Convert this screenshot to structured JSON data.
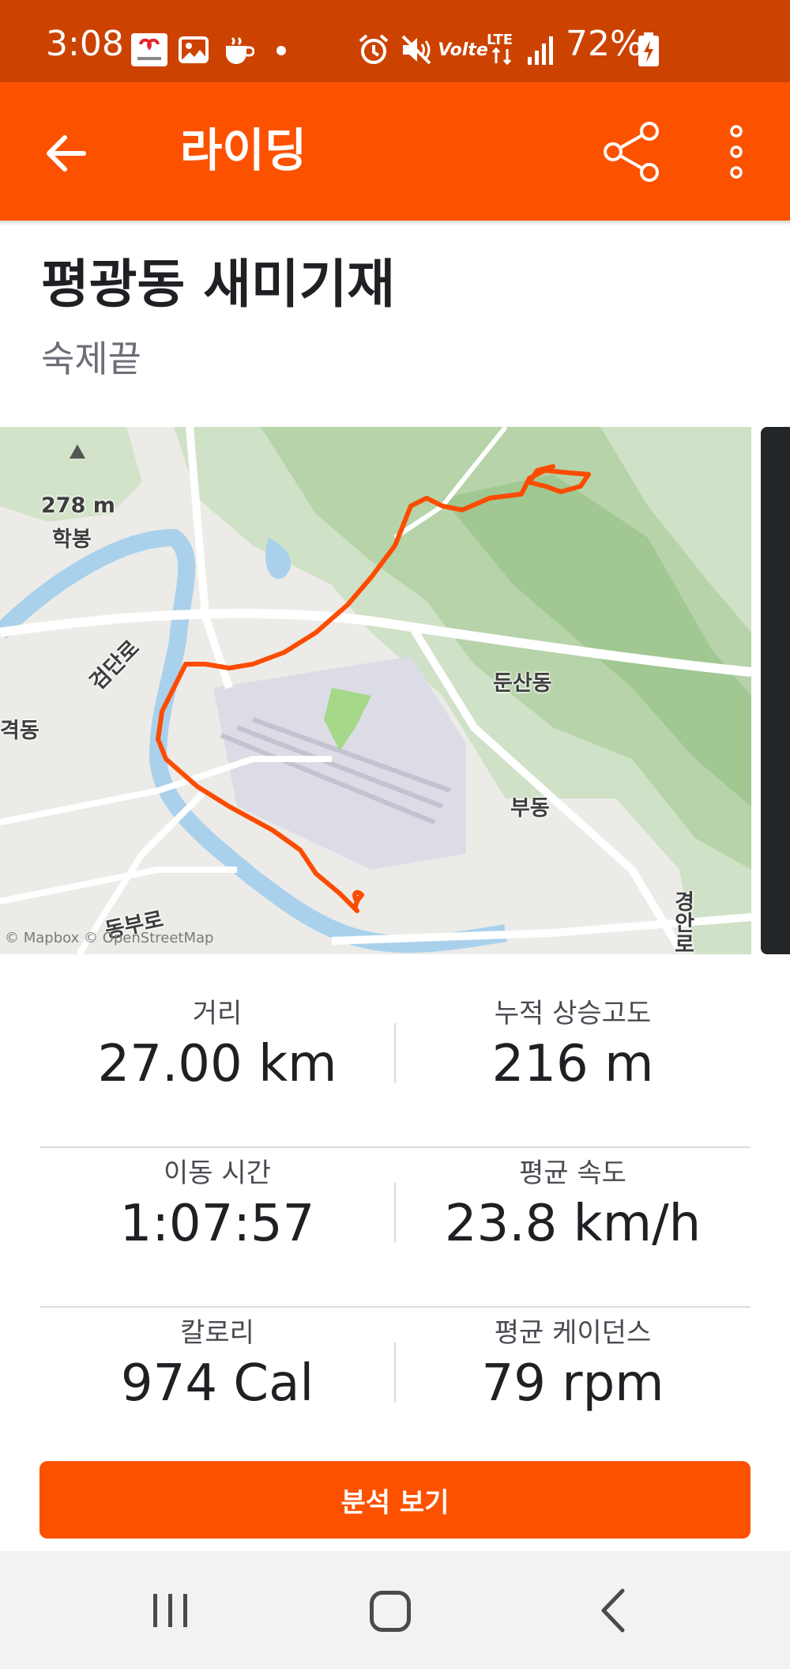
{
  "status_bar": {
    "time": "3:08",
    "battery_percent": "72%",
    "network": "LTE",
    "volte": "Volte",
    "icons": [
      "benepia-icon",
      "gallery-icon",
      "coffee-cup-icon",
      "notification-dot-icon",
      "alarm-icon",
      "mute-icon",
      "volte-icon",
      "lte-data-icon",
      "signal-icon",
      "battery-charging-icon"
    ]
  },
  "app_bar": {
    "title": "라이딩",
    "back_icon": "arrow-left-icon",
    "share_icon": "share-icon",
    "more_icon": "more-vertical-icon"
  },
  "activity": {
    "name": "평광동 새미기재",
    "location": "숙제끝"
  },
  "map": {
    "labels": {
      "peak_elev": "278 m",
      "peak_name": "학봉",
      "road1": "검단로",
      "district1": "둔산동",
      "district2": "부동",
      "district3": "격동",
      "road2": "동부로",
      "road3": "경안로"
    },
    "attribution": "© Mapbox © OpenStreetMap",
    "route_color": "#fc4c02"
  },
  "stats": [
    {
      "left": {
        "label": "거리",
        "value": "27.00 km"
      },
      "right": {
        "label": "누적 상승고도",
        "value": "216 m"
      }
    },
    {
      "left": {
        "label": "이동 시간",
        "value": "1:07:57"
      },
      "right": {
        "label": "평균 속도",
        "value": "23.8 km/h"
      }
    },
    {
      "left": {
        "label": "칼로리",
        "value": "974 Cal"
      },
      "right": {
        "label": "평균 케이던스",
        "value": "79 rpm"
      }
    }
  ],
  "analysis_button": "분석 보기",
  "nav_bar": {
    "recent_icon": "recent-apps-icon",
    "home_icon": "home-icon",
    "back_icon": "nav-back-icon"
  },
  "colors": {
    "brand_orange": "#fc5200",
    "status_bar": "#cc4200"
  }
}
